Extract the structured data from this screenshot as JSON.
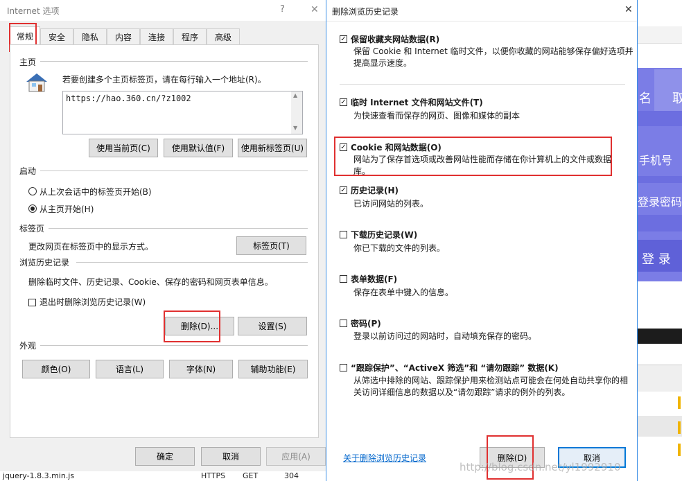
{
  "bg": {
    "right_texts": [
      "名",
      "取",
      "手机号",
      "登录密码",
      "登 录"
    ],
    "bottom_left": [
      "jquery-1.8.3.min.js",
      "HTTPS",
      "GET",
      "304"
    ],
    "watermark": "http://blog.csdn.net/yl1992910"
  },
  "left": {
    "title": "Internet 选项",
    "help": "?",
    "close": "✕",
    "tabs": [
      "常规",
      "安全",
      "隐私",
      "内容",
      "连接",
      "程序",
      "高级"
    ],
    "home": {
      "header": "主页",
      "desc": "若要创建多个主页标签页，请在每行输入一个地址(R)。",
      "url": "https://hao.360.cn/?z1002",
      "btn_current": "使用当前页(C)",
      "btn_default": "使用默认值(F)",
      "btn_newtab": "使用新标签页(U)"
    },
    "startup": {
      "header": "启动",
      "opt_last": "从上次会话中的标签页开始(B)",
      "opt_home": "从主页开始(H)"
    },
    "tabs_section": {
      "header": "标签页",
      "desc": "更改网页在标签页中的显示方式。",
      "btn": "标签页(T)"
    },
    "history": {
      "header": "浏览历史记录",
      "desc": "删除临时文件、历史记录、Cookie、保存的密码和网页表单信息。",
      "checkbox": "退出时删除浏览历史记录(W)",
      "btn_delete": "删除(D)...",
      "btn_settings": "设置(S)"
    },
    "appearance": {
      "header": "外观",
      "btn_colors": "颜色(O)",
      "btn_language": "语言(L)",
      "btn_fonts": "字体(N)",
      "btn_accessibility": "辅助功能(E)"
    },
    "footer": {
      "ok": "确定",
      "cancel": "取消",
      "apply": "应用(A)"
    }
  },
  "right": {
    "title": "删除浏览历史记录",
    "close": "✕",
    "items": [
      {
        "title": "保留收藏夹网站数据(R)",
        "desc": "保留 Cookie 和 Internet 临时文件，以便你收藏的网站能够保存偏好选项并提高显示速度。",
        "checked": true
      },
      {
        "title": "临时 Internet 文件和网站文件(T)",
        "desc": "为快速查看而保存的网页、图像和媒体的副本",
        "checked": true
      },
      {
        "title": "Cookie 和网站数据(O)",
        "desc": "网站为了保存首选项或改善网站性能而存储在你计算机上的文件或数据库。",
        "checked": true
      },
      {
        "title": "历史记录(H)",
        "desc": "已访问网站的列表。",
        "checked": true
      },
      {
        "title": "下载历史记录(W)",
        "desc": "你已下载的文件的列表。",
        "checked": false
      },
      {
        "title": "表单数据(F)",
        "desc": "保存在表单中键入的信息。",
        "checked": false
      },
      {
        "title": "密码(P)",
        "desc": "登录以前访问过的网站时，自动填充保存的密码。",
        "checked": false
      },
      {
        "title": "“跟踪保护”、“ActiveX 筛选”和 “请勿跟踪” 数据(K)",
        "desc": "从筛选中排除的网站、跟踪保护用来检测站点可能会在何处自动共享你的相关访问详细信息的数据以及“请勿跟踪”请求的例外的列表。",
        "checked": false
      }
    ],
    "link": "关于删除浏览历史记录",
    "btn_delete": "删除(D)",
    "btn_cancel": "取消"
  },
  "colors": {
    "accent": "#0078d7",
    "highlight_red": "#e03030",
    "web_purple": "#7b7de6"
  }
}
